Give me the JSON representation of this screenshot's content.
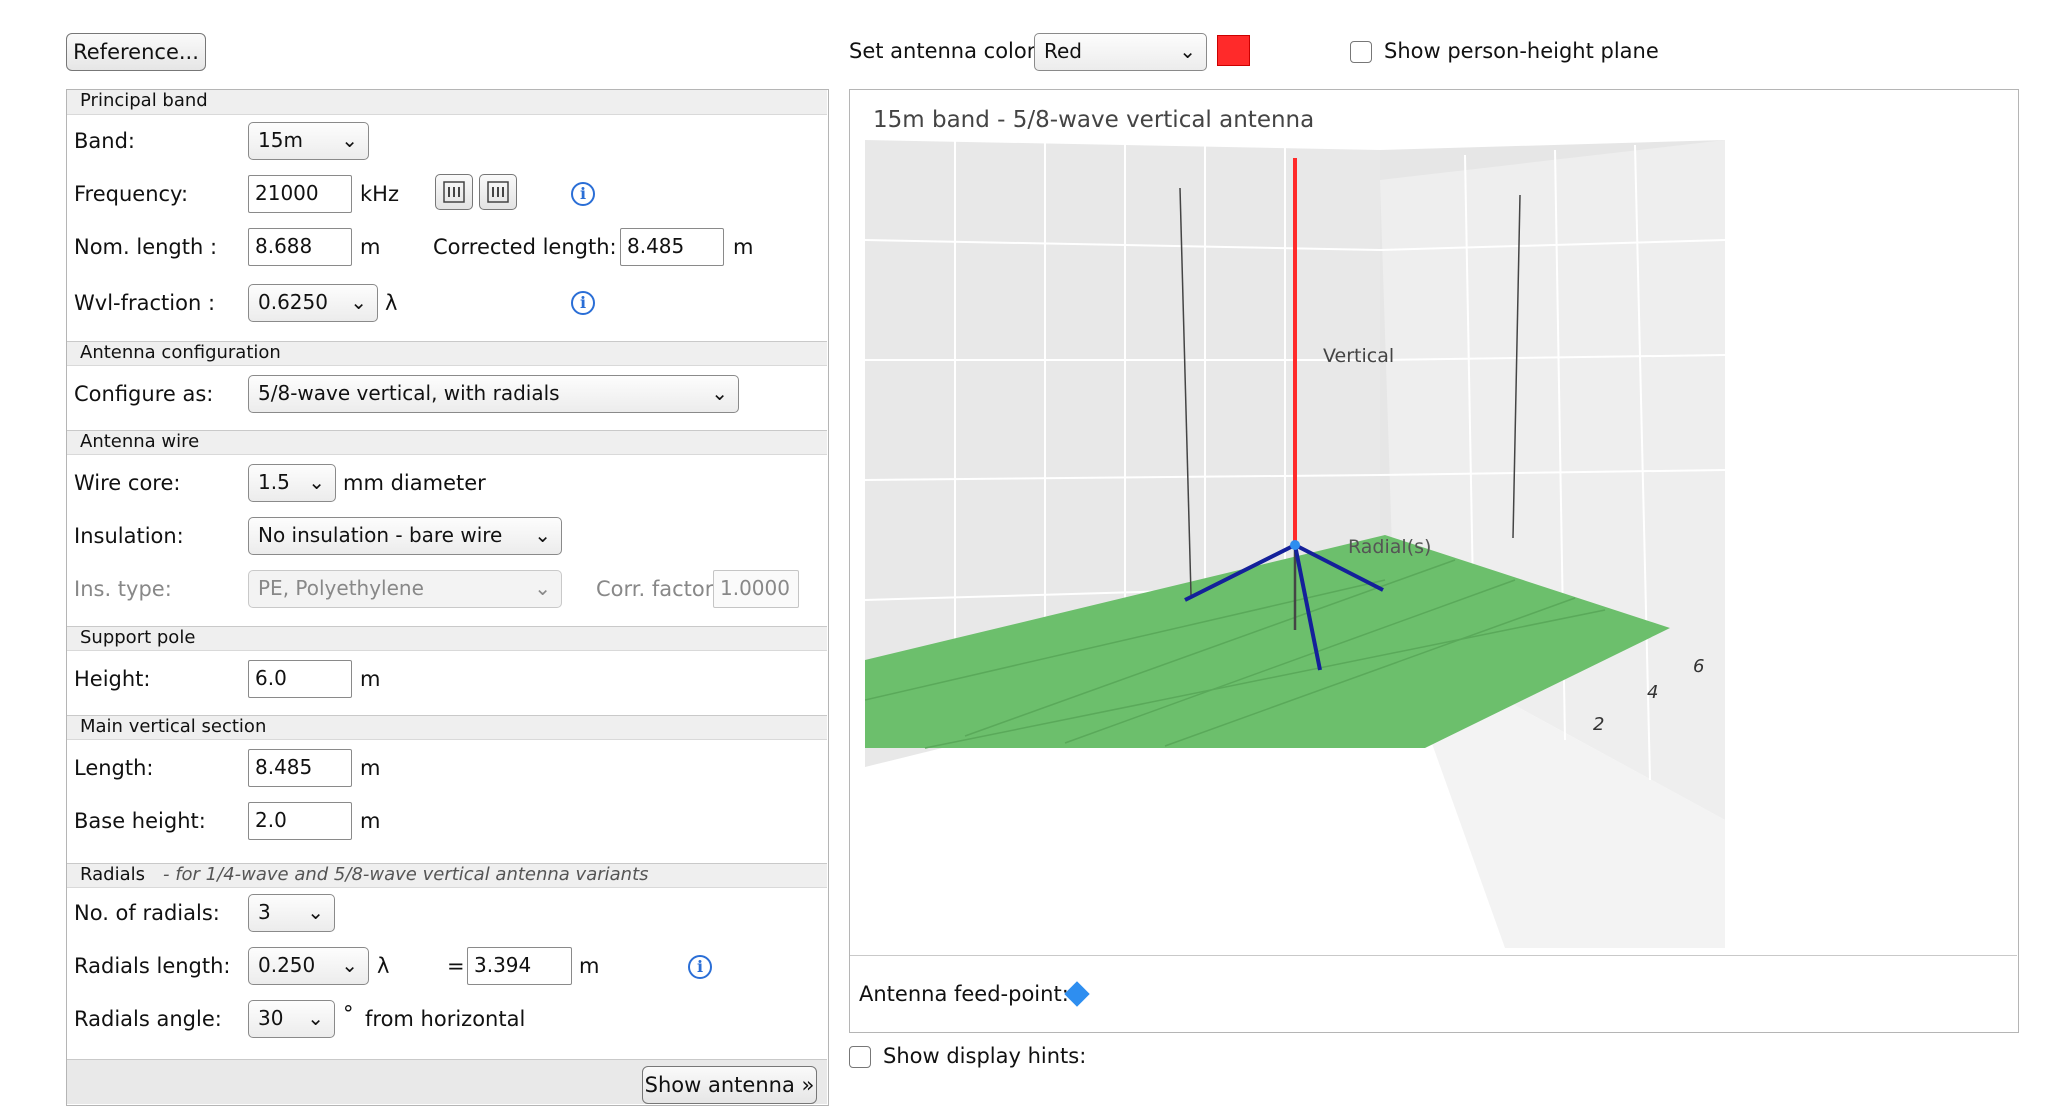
{
  "top": {
    "reference_label": "Reference...",
    "antenna_color_label": "Set antenna color:",
    "antenna_color_value": "Red",
    "antenna_color_hex": "#ff2a2a",
    "person_plane_label": "Show person-height plane"
  },
  "principal_band": {
    "header": "Principal band",
    "band_label": "Band:",
    "band_value": "15m",
    "frequency_label": "Frequency:",
    "frequency_value": "21000",
    "frequency_unit": "kHz",
    "nom_length_label": "Nom. length :",
    "nom_length_value": "8.688",
    "nom_length_unit": "m",
    "corrected_length_label": "Corrected length:",
    "corrected_length_value": "8.485",
    "corrected_length_unit": "m",
    "wvl_label": "Wvl-fraction :",
    "wvl_value": "0.6250",
    "wvl_unit": "λ"
  },
  "antenna_configuration": {
    "header": "Antenna configuration",
    "configure_label": "Configure as:",
    "configure_value": "5/8-wave  vertical,  with radials"
  },
  "antenna_wire": {
    "header": "Antenna wire",
    "wire_core_label": "Wire core:",
    "wire_core_value": "1.5",
    "wire_core_unit": "mm  diameter",
    "insulation_label": "Insulation:",
    "insulation_value": "No insulation - bare wire",
    "ins_type_label": "Ins. type:",
    "ins_type_value": "PE, Polyethylene",
    "corr_factor_label": "Corr. factor:",
    "corr_factor_value": "1.0000"
  },
  "support_pole": {
    "header": "Support pole",
    "height_label": "Height:",
    "height_value": "6.0",
    "height_unit": "m"
  },
  "main_vertical": {
    "header": "Main vertical section",
    "length_label": "Length:",
    "length_value": "8.485",
    "length_unit": "m",
    "base_height_label": "Base height:",
    "base_height_value": "2.0",
    "base_height_unit": "m"
  },
  "radials": {
    "header": "Radials",
    "note": "- for 1/4-wave and 5/8-wave vertical antenna variants",
    "count_label": "No. of radials:",
    "count_value": "3",
    "length_label": "Radials length:",
    "length_value": "0.250",
    "length_unit": "λ",
    "equals": "=",
    "length_m_value": "3.394",
    "length_m_unit": "m",
    "angle_label": "Radials angle:",
    "angle_value": "30",
    "angle_unit": "°",
    "angle_suffix": "from horizontal"
  },
  "show_antenna_label": "Show antenna »",
  "plot": {
    "title": "15m band - 5/8-wave vertical antenna",
    "vertical_label": "Vertical",
    "radials_label": "Radial(s)",
    "axis_ticks": [
      "6",
      "4",
      "2"
    ],
    "feed_point_label": "Antenna feed-point:",
    "feed_point_color": "#2e8ef0",
    "ground_color": "#6cbf6c",
    "radial_color": "#14209a"
  },
  "display_hints_label": "Show display hints:"
}
